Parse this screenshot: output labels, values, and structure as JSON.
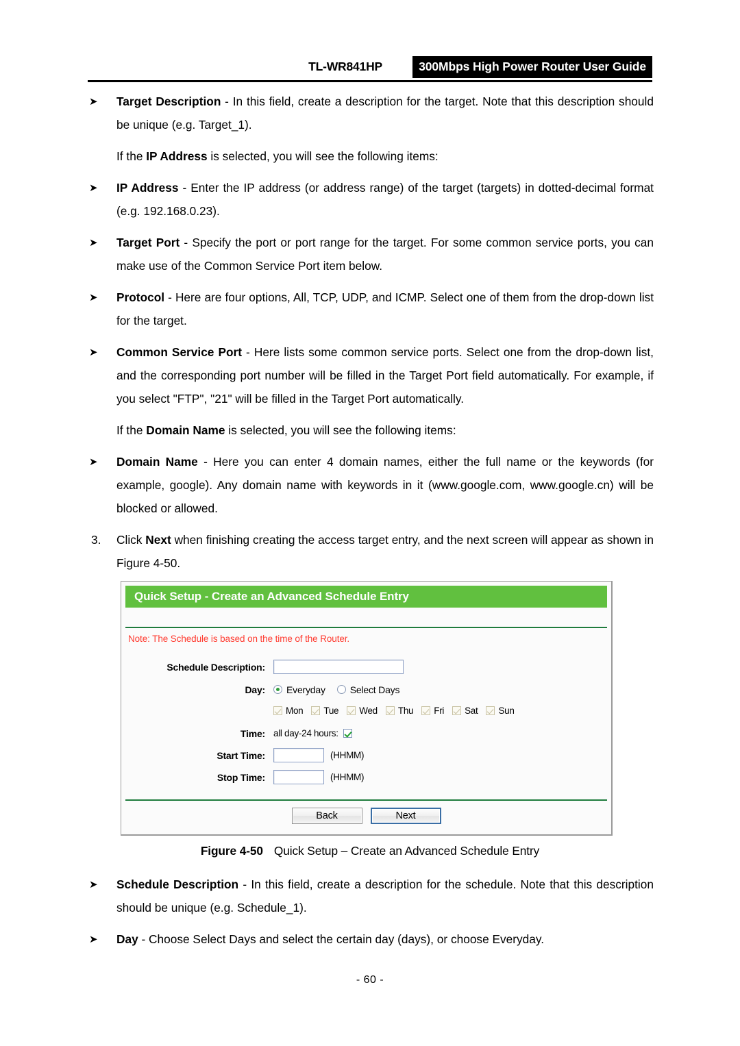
{
  "header": {
    "model": "TL-WR841HP",
    "guide_title": "300Mbps High Power Router User Guide"
  },
  "body_top": {
    "target_description": {
      "term": "Target Description",
      "text": " - In this field, create a description for the target. Note that this description should be unique (e.g. Target_1)."
    },
    "ip_address_intro_pre": "If the ",
    "ip_address_intro_term": "IP Address",
    "ip_address_intro_post": " is selected, you will see the following items:",
    "ip_address": {
      "term": "IP Address",
      "text": " - Enter the IP address (or address range) of the target (targets) in dotted-decimal format (e.g. 192.168.0.23)."
    },
    "target_port": {
      "term": "Target Port",
      "text": " - Specify the port or port range for the target. For some common service ports, you can make use of the Common Service Port item below."
    },
    "protocol": {
      "term": "Protocol",
      "text": " - Here are four options, All, TCP, UDP, and ICMP. Select one of them from the drop-down list for the target."
    },
    "common_service_port": {
      "term": "Common Service Port",
      "text": " - Here lists some common service ports. Select one from the drop-down list, and the corresponding port number will be filled in the Target Port field automatically. For example, if you select \"FTP\", \"21\" will be filled in the Target Port automatically."
    },
    "domain_intro_pre": "If the ",
    "domain_intro_term": "Domain Name",
    "domain_intro_post": " is selected, you will see the following items:",
    "domain_name": {
      "term": "Domain Name",
      "text": " - Here you can enter 4 domain names, either the full name or the keywords (for example, google). Any domain name with keywords in it (www.google.com, www.google.cn) will be blocked or allowed."
    },
    "step3": {
      "number": "3.",
      "pre": "Click ",
      "term": "Next",
      "post": " when finishing creating the access target entry, and the next screen will appear as shown in Figure 4-50."
    }
  },
  "figure": {
    "panel": {
      "title": "Quick Setup - Create an Advanced Schedule Entry",
      "note": "Note: The Schedule is based on the time of the Router.",
      "fields": {
        "schedule_description_label": "Schedule Description:",
        "schedule_description_value": "",
        "day_label": "Day:",
        "day_options": [
          {
            "label": "Everyday",
            "selected": true
          },
          {
            "label": "Select Days",
            "selected": false
          }
        ],
        "days": [
          {
            "label": "Mon",
            "checked": true,
            "disabled": true
          },
          {
            "label": "Tue",
            "checked": true,
            "disabled": true
          },
          {
            "label": "Wed",
            "checked": true,
            "disabled": true
          },
          {
            "label": "Thu",
            "checked": true,
            "disabled": true
          },
          {
            "label": "Fri",
            "checked": true,
            "disabled": true
          },
          {
            "label": "Sat",
            "checked": true,
            "disabled": true
          },
          {
            "label": "Sun",
            "checked": true,
            "disabled": true
          }
        ],
        "time_label": "Time:",
        "all_day_label": "all day-24 hours:",
        "all_day_checked": true,
        "start_time_label": "Start Time:",
        "start_time_value": "",
        "start_time_hint": "(HHMM)",
        "stop_time_label": "Stop Time:",
        "stop_time_value": "",
        "stop_time_hint": "(HHMM)"
      },
      "buttons": {
        "back": "Back",
        "next": "Next"
      }
    },
    "caption_number": "Figure 4-50",
    "caption_text": "Quick Setup – Create an Advanced Schedule Entry"
  },
  "body_bottom": {
    "schedule_description": {
      "term": "Schedule Description",
      "text": " - In this field, create a description for the schedule. Note that this description should be unique (e.g. Schedule_1)."
    },
    "day": {
      "term": "Day",
      "text": " - Choose Select Days and select the certain day (days), or choose Everyday."
    }
  },
  "footer": {
    "page_number": "- 60 -"
  },
  "colors": {
    "panel_green": "#61c03f",
    "rule_green": "#1e7b3c",
    "note_red": "#ff3b30",
    "check_green": "#1f9e2e"
  }
}
